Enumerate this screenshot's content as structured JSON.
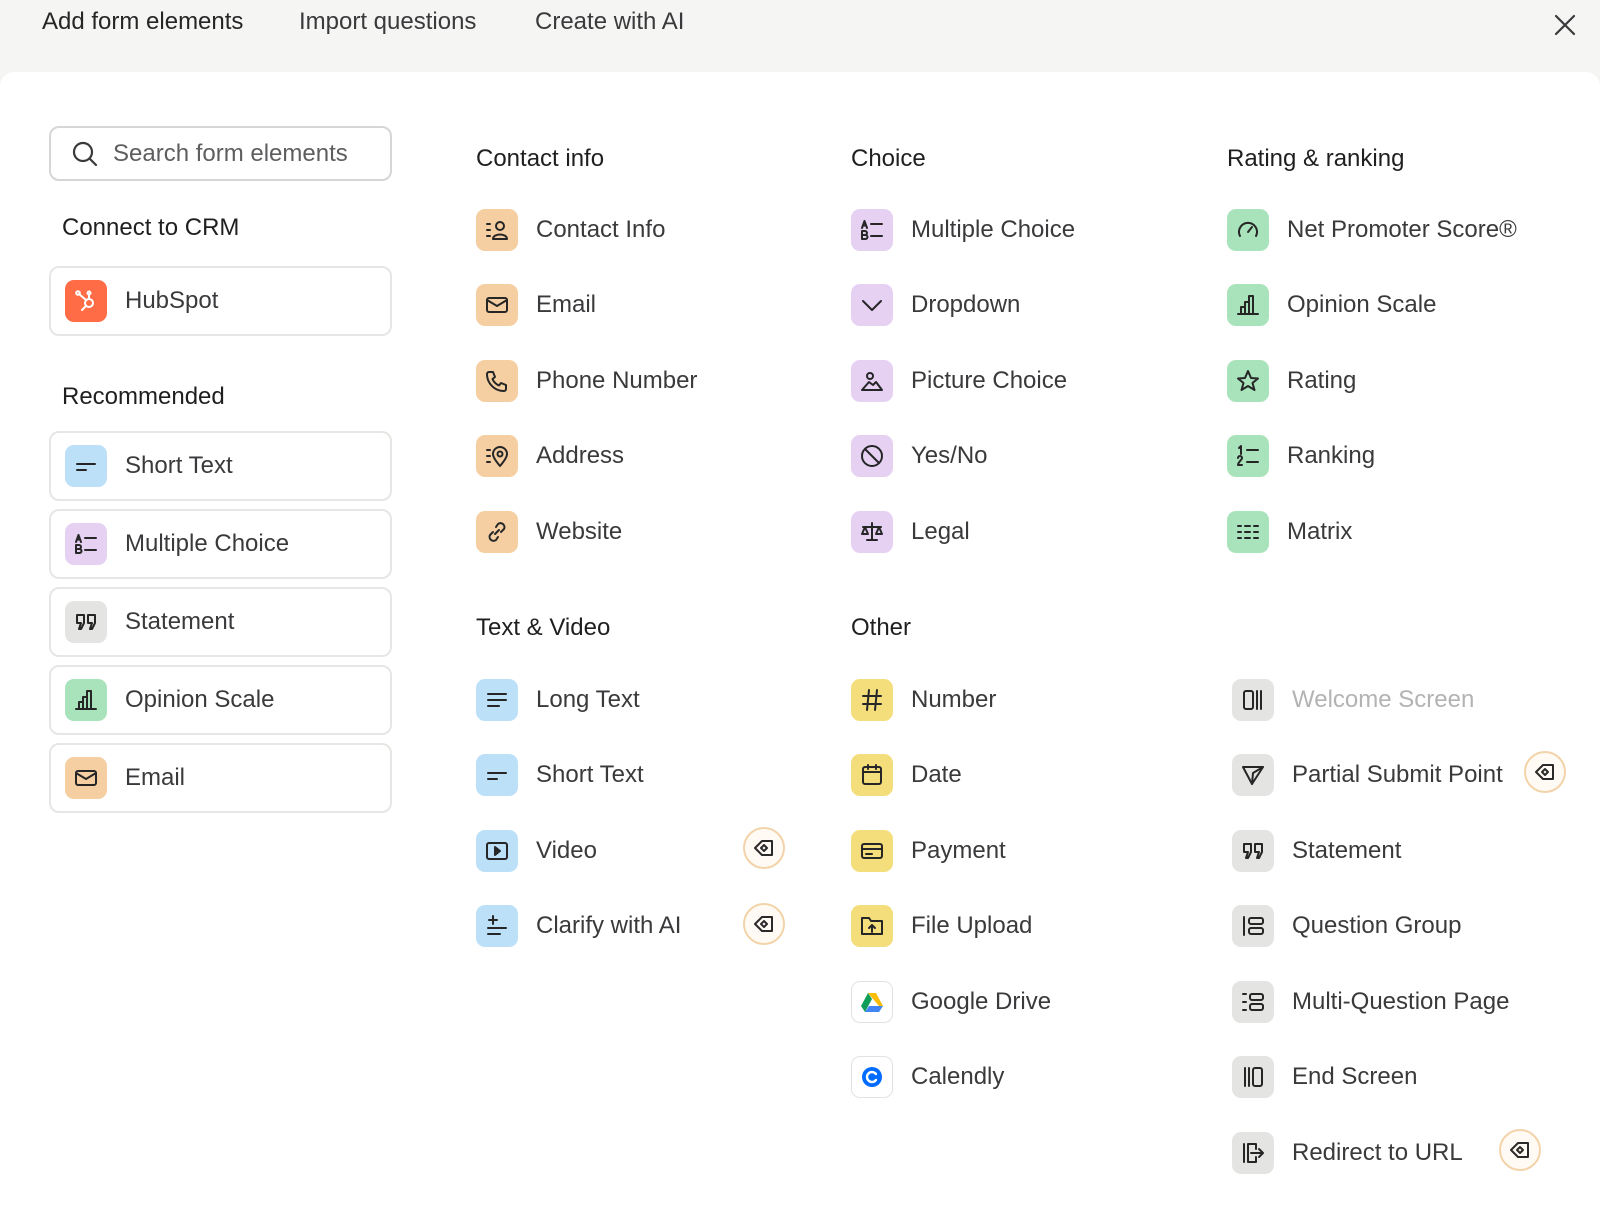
{
  "tabs": [
    {
      "label": "Add form elements",
      "active": true
    },
    {
      "label": "Import questions",
      "active": false
    },
    {
      "label": "Create with AI",
      "active": false
    }
  ],
  "search": {
    "placeholder": "Search form elements"
  },
  "left": {
    "crm_title": "Connect to CRM",
    "crm_item": {
      "label": "HubSpot",
      "icon": "hubspot-icon"
    },
    "recommended_title": "Recommended",
    "recommended": [
      {
        "label": "Short Text",
        "icon": "short-text-icon",
        "color": "blue"
      },
      {
        "label": "Multiple Choice",
        "icon": "multiple-choice-icon",
        "color": "purple"
      },
      {
        "label": "Statement",
        "icon": "quote-icon",
        "color": "gray"
      },
      {
        "label": "Opinion Scale",
        "icon": "bar-chart-icon",
        "color": "green"
      },
      {
        "label": "Email",
        "icon": "envelope-icon",
        "color": "orange"
      }
    ]
  },
  "contact_info": {
    "title": "Contact info",
    "items": [
      {
        "label": "Contact Info",
        "icon": "contact-card-icon"
      },
      {
        "label": "Email",
        "icon": "envelope-icon"
      },
      {
        "label": "Phone Number",
        "icon": "phone-icon"
      },
      {
        "label": "Address",
        "icon": "location-pin-icon"
      },
      {
        "label": "Website",
        "icon": "link-icon"
      }
    ]
  },
  "choice": {
    "title": "Choice",
    "items": [
      {
        "label": "Multiple Choice",
        "icon": "multiple-choice-icon"
      },
      {
        "label": "Dropdown",
        "icon": "chevron-down-icon"
      },
      {
        "label": "Picture Choice",
        "icon": "picture-icon"
      },
      {
        "label": "Yes/No",
        "icon": "yes-no-icon"
      },
      {
        "label": "Legal",
        "icon": "scales-icon"
      }
    ]
  },
  "rating": {
    "title": "Rating & ranking",
    "items": [
      {
        "label": "Net Promoter Score®",
        "icon": "gauge-icon"
      },
      {
        "label": "Opinion Scale",
        "icon": "bar-chart-icon"
      },
      {
        "label": "Rating",
        "icon": "star-icon"
      },
      {
        "label": "Ranking",
        "icon": "numbered-list-icon"
      },
      {
        "label": "Matrix",
        "icon": "matrix-icon"
      }
    ]
  },
  "text_video": {
    "title": "Text & Video",
    "items": [
      {
        "label": "Long Text",
        "icon": "long-text-icon",
        "premium": false
      },
      {
        "label": "Short Text",
        "icon": "short-text-icon",
        "premium": false
      },
      {
        "label": "Video",
        "icon": "video-icon",
        "premium": true
      },
      {
        "label": "Clarify with AI",
        "icon": "ai-sparkle-icon",
        "premium": true
      }
    ]
  },
  "other": {
    "title": "Other",
    "items": [
      {
        "label": "Number",
        "icon": "hash-icon"
      },
      {
        "label": "Date",
        "icon": "calendar-icon"
      },
      {
        "label": "Payment",
        "icon": "credit-card-icon"
      },
      {
        "label": "File Upload",
        "icon": "file-upload-icon"
      },
      {
        "label": "Google Drive",
        "icon": "google-drive-icon"
      },
      {
        "label": "Calendly",
        "icon": "calendly-icon"
      }
    ]
  },
  "screens": {
    "items": [
      {
        "label": "Welcome Screen",
        "icon": "welcome-screen-icon",
        "disabled": true,
        "premium": false
      },
      {
        "label": "Partial Submit Point",
        "icon": "send-icon",
        "disabled": false,
        "premium": true
      },
      {
        "label": "Statement",
        "icon": "quote-icon",
        "disabled": false,
        "premium": false
      },
      {
        "label": "Question Group",
        "icon": "question-group-icon",
        "disabled": false,
        "premium": false
      },
      {
        "label": "Multi-Question Page",
        "icon": "multi-question-icon",
        "disabled": false,
        "premium": false
      },
      {
        "label": "End Screen",
        "icon": "end-screen-icon",
        "disabled": false,
        "premium": false
      },
      {
        "label": "Redirect to URL",
        "icon": "redirect-icon",
        "disabled": false,
        "premium": true
      }
    ]
  },
  "colors": {
    "orange": "#f5cfa2",
    "purple": "#e6d1f3",
    "green": "#a8e3bb",
    "blue": "#bde0f9",
    "yellow": "#f4de7c",
    "gray": "#e4e4e3",
    "hubspot": "#ff6c46",
    "premium_badge_border": "#f3d3a9"
  }
}
